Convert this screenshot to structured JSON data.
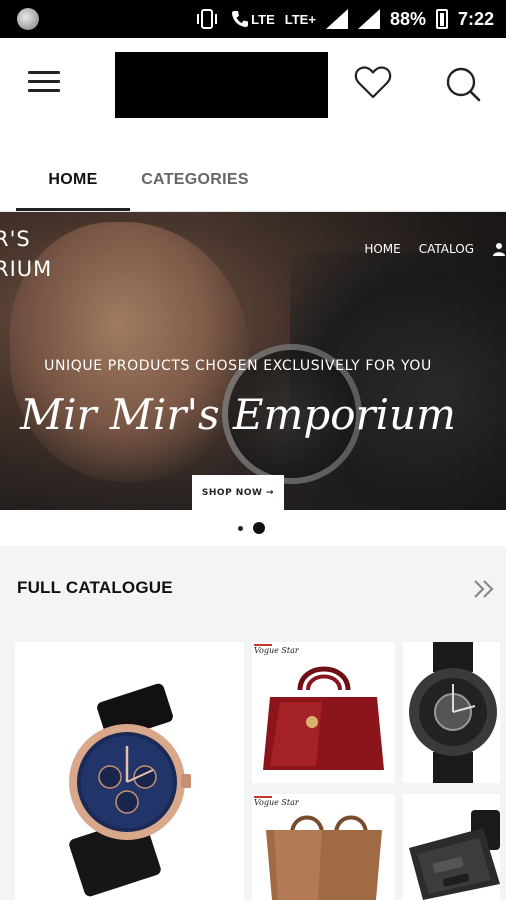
{
  "status_bar": {
    "lte_label": "LTE",
    "lte_plus_label": "LTE+",
    "battery": "88%",
    "time": "7:22"
  },
  "app_bar": {
    "menu_icon": "hamburger-icon",
    "wishlist_icon": "heart-icon",
    "search_icon": "search-icon"
  },
  "tabs": [
    {
      "label": "HOME",
      "selected": true
    },
    {
      "label": "CATEGORIES",
      "selected": false
    }
  ],
  "banner": {
    "brand_line1": "R'S",
    "brand_line2": "RIUM",
    "nav": {
      "home": "HOME",
      "catalog": "CATALOG"
    },
    "tagline": "UNIQUE PRODUCTS CHOSEN EXCLUSIVELY FOR YOU",
    "title": "Mir Mir's Emporium",
    "shop_now": "SHOP NOW →",
    "slide_count": 2,
    "active_slide": 2
  },
  "catalogue": {
    "title": "FULL CATALOGUE",
    "more_icon": "double-chevron-right-icon",
    "brand_tag": "Vogue Star",
    "items": [
      {
        "kind": "wristwatch-blue-dial"
      },
      {
        "kind": "red-handbag"
      },
      {
        "kind": "black-sport-watch"
      },
      {
        "kind": "brown-tote-bag"
      },
      {
        "kind": "black-organizer-case"
      }
    ]
  },
  "colors": {
    "status_bar_bg": "#000000",
    "text_primary": "#111111",
    "tab_inactive": "#666666",
    "section_bg": "#f4f4f4"
  }
}
